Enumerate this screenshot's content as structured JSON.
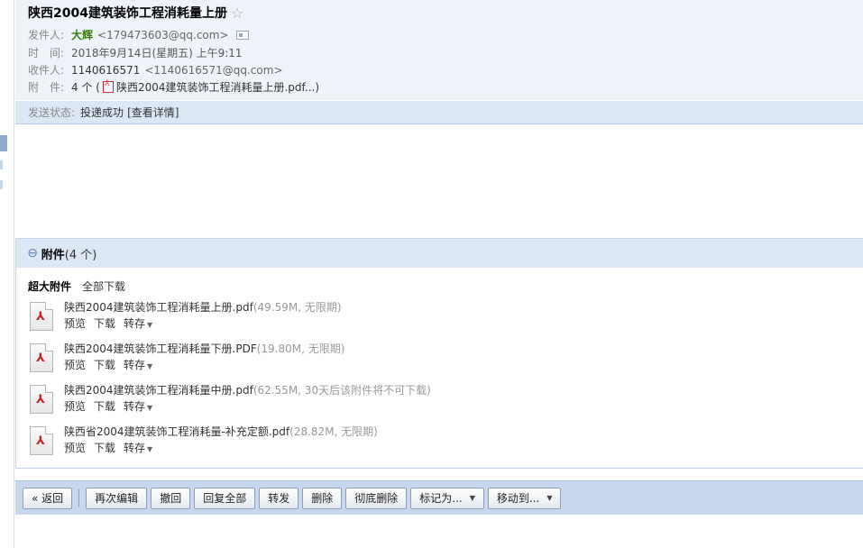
{
  "email": {
    "subject": "陕西2004建筑装饰工程消耗量上册",
    "star_icon": "star-icon",
    "sender_label": "发件人:",
    "sender_name": "大辉",
    "sender_email": "<179473603@qq.com>",
    "time_label": "时　间:",
    "time_value": "2018年9月14日(星期五) 上午9:11",
    "recipient_label": "收件人:",
    "recipient_name": "1140616571",
    "recipient_email": "<1140616571@qq.com>",
    "attachment_label": "附　件:",
    "attachment_summary_prefix": "4 个 (",
    "attachment_summary_file": "陕西2004建筑装饰工程消耗量上册.pdf...)",
    "status_label": "发送状态:",
    "status_value": "投递成功",
    "status_link": "[查看详情]"
  },
  "attachments": {
    "header_title": "附件",
    "header_count": "(4 个)",
    "large_label": "超大附件",
    "download_all": "全部下载",
    "files": [
      {
        "name": "陕西2004建筑装饰工程消耗量上册.pdf",
        "meta": "(49.59M, 无限期)"
      },
      {
        "name": "陕西2004建筑装饰工程消耗量下册.PDF",
        "meta": "(19.80M, 无限期)"
      },
      {
        "name": "陕西2004建筑装饰工程消耗量中册.pdf",
        "meta": "(62.55M, 30天后该附件将不可下载)"
      },
      {
        "name": "陕西省2004建筑装饰工程消耗量-补充定额.pdf",
        "meta": "(28.82M, 无限期)"
      }
    ],
    "actions": {
      "preview": "预览",
      "download": "下载",
      "save": "转存"
    }
  },
  "toolbar": {
    "back": "« 返回",
    "edit_again": "再次编辑",
    "recall": "撤回",
    "reply_all": "回复全部",
    "forward": "转发",
    "delete": "删除",
    "delete_permanently": "彻底删除",
    "mark_as": "标记为...",
    "move_to": "移动到..."
  }
}
